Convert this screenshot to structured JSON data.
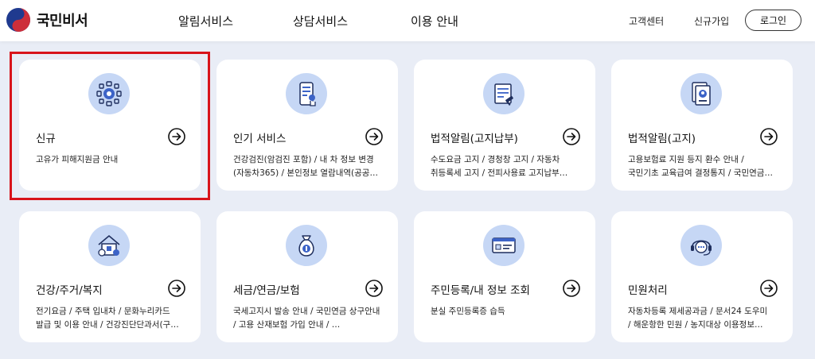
{
  "header": {
    "logo_text": "국민비서",
    "nav": [
      "알림서비스",
      "상담서비스",
      "이용 안내"
    ],
    "util": [
      "고객센터",
      "신규가입"
    ],
    "login": "로그인"
  },
  "cards": [
    {
      "title": "신규",
      "icon": "gear-people-icon",
      "lines": [
        "고유가 피해지원금 안내"
      ]
    },
    {
      "title": "인기 서비스",
      "icon": "mobile-touch-icon",
      "lines": [
        "건강검진(암검진 포함)  / 내 차 정보 변경",
        "(자동차365)  / 본인정보 열람내역(공공…"
      ]
    },
    {
      "title": "법적알림(고지납부)",
      "icon": "document-gavel-icon",
      "lines": [
        "수도요금 고지  / 경청창 고지  / 자동차",
        "취등록세 고지  / 전피사용료 고지납부…"
      ]
    },
    {
      "title": "법적알림(고지)",
      "icon": "document-badge-icon",
      "lines": [
        "고용보험료 지원 등지 환수 안내  /",
        "국민기초 교육급여 결정통지  / 국민연금…"
      ]
    },
    {
      "title": "건강/주거/복지",
      "icon": "house-health-icon",
      "lines": [
        "전기요금  / 주택 입내차  / 문화누리카드",
        "발급 및 이용 안내  / 건강진단단과서(구…"
      ]
    },
    {
      "title": "세금/연금/보험",
      "icon": "money-bag-icon",
      "lines": [
        "국세고지시 발송 안내  / 국민연금 상구안내",
        " / 고용 산재보험 가입 안내  / …"
      ]
    },
    {
      "title": "주민등록/내 정보 조회",
      "icon": "id-card-icon",
      "lines": [
        "분실 주민등록증 습득"
      ]
    },
    {
      "title": "민원처리",
      "icon": "headset-chat-icon",
      "lines": [
        "자동차등록 제세공과금  / 문서24 도우미",
        " / 해운항한 민원  / 농지대상 이용정보…"
      ]
    }
  ]
}
